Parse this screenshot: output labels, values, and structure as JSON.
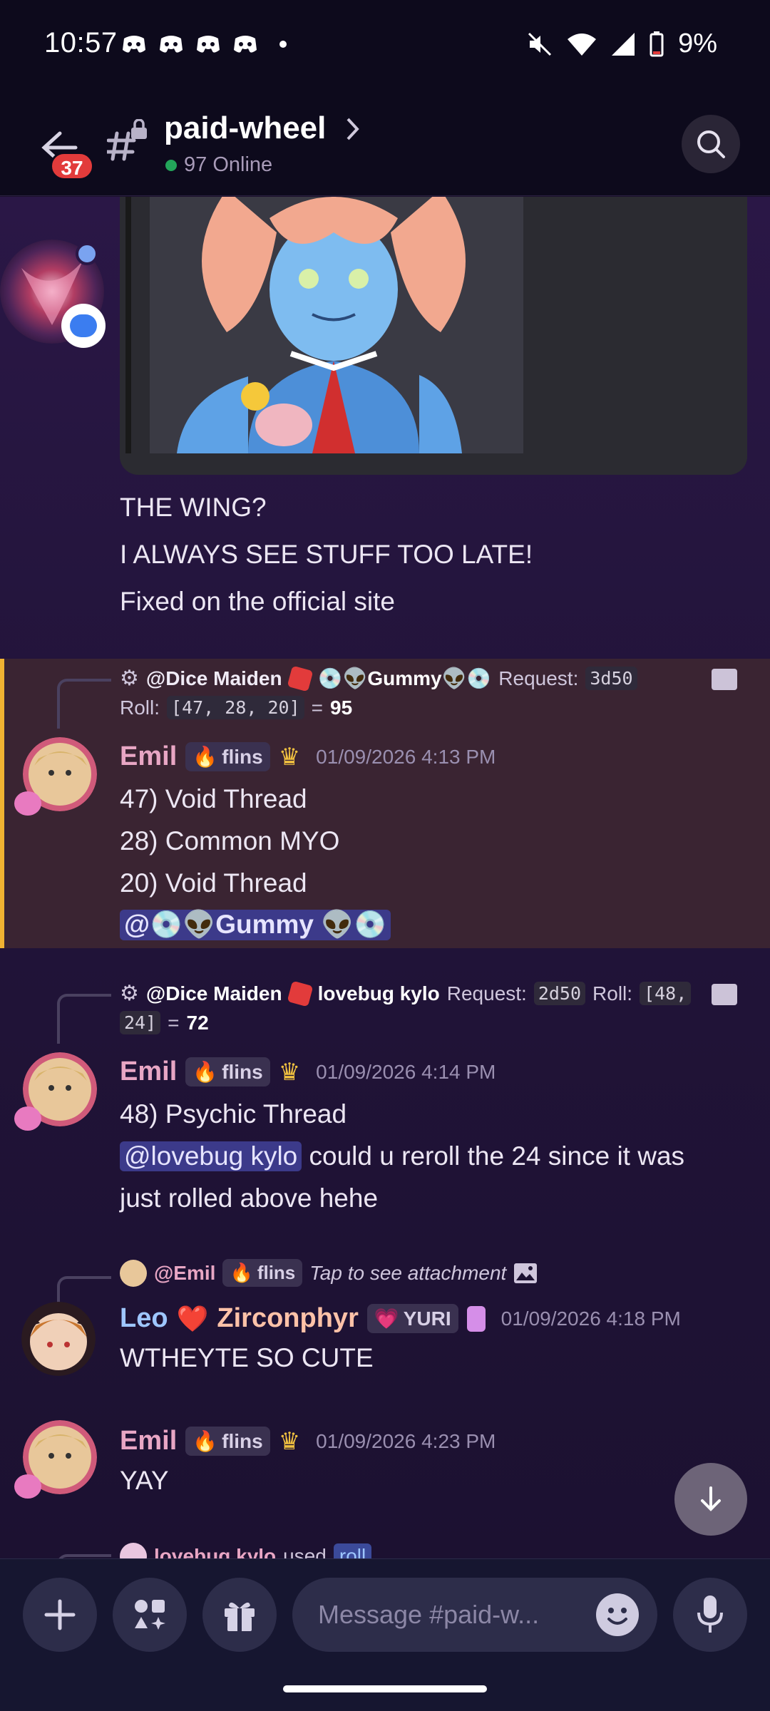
{
  "status_bar": {
    "time": "10:57",
    "battery": "9%"
  },
  "header": {
    "unread_badge": "37",
    "channel_name": "paid-wheel",
    "online_text": "97 Online"
  },
  "messages": {
    "top": {
      "lines": [
        "THE WING?",
        "I ALWAYS SEE STUFF TOO LATE!",
        "Fixed on the official site"
      ]
    },
    "m1": {
      "reply": {
        "bot": "@Dice Maiden",
        "user": "💿👽Gummy👽💿",
        "request_label": "Request:",
        "request": "3d50",
        "roll_label": "Roll:",
        "roll": "[47, 28, 20]",
        "eq": "=",
        "total": "95"
      },
      "author": "Emil",
      "tag": "flins",
      "time": "01/09/2026 4:13 PM",
      "lines": [
        "47) Void Thread",
        "28) Common MYO",
        "20) Void Thread"
      ],
      "mention": "@💿👽Gummy 👽💿"
    },
    "m2": {
      "reply": {
        "bot": "@Dice Maiden",
        "user": "lovebug kylo",
        "request_label": "Request:",
        "request": "2d50",
        "roll_label": "Roll:",
        "roll_a": "[48,",
        "roll_b": "24]",
        "eq": "=",
        "total": "72"
      },
      "author": "Emil",
      "tag": "flins",
      "time": "01/09/2026 4:14 PM",
      "line1": "48) Psychic Thread",
      "mention": "@lovebug kylo",
      "line2_rest": " could u reroll the 24 since it was",
      "line3": "just rolled above hehe"
    },
    "m3": {
      "reply": {
        "user": "@Emil",
        "tag": "flins",
        "note": "Tap to see attachment"
      },
      "author_a": "Leo",
      "heart": "❤️",
      "author_b": "Zirconphyr",
      "tag": "YURI",
      "time": "01/09/2026 4:18 PM",
      "line": "WTHEYTE SO CUTE"
    },
    "m4": {
      "author": "Emil",
      "tag": "flins",
      "time": "01/09/2026 4:23 PM",
      "line": "YAY"
    },
    "m5": {
      "user": "lovebug kylo",
      "used": "used",
      "command": "roll"
    }
  },
  "composer": {
    "placeholder": "Message #paid-w..."
  },
  "colors": {
    "emil": "#e8a6c4",
    "leo": "#9ec6ff",
    "zirconphyr": "#ffc2a8",
    "badge": "#e23b3b",
    "highlight_border": "#f0b232"
  }
}
